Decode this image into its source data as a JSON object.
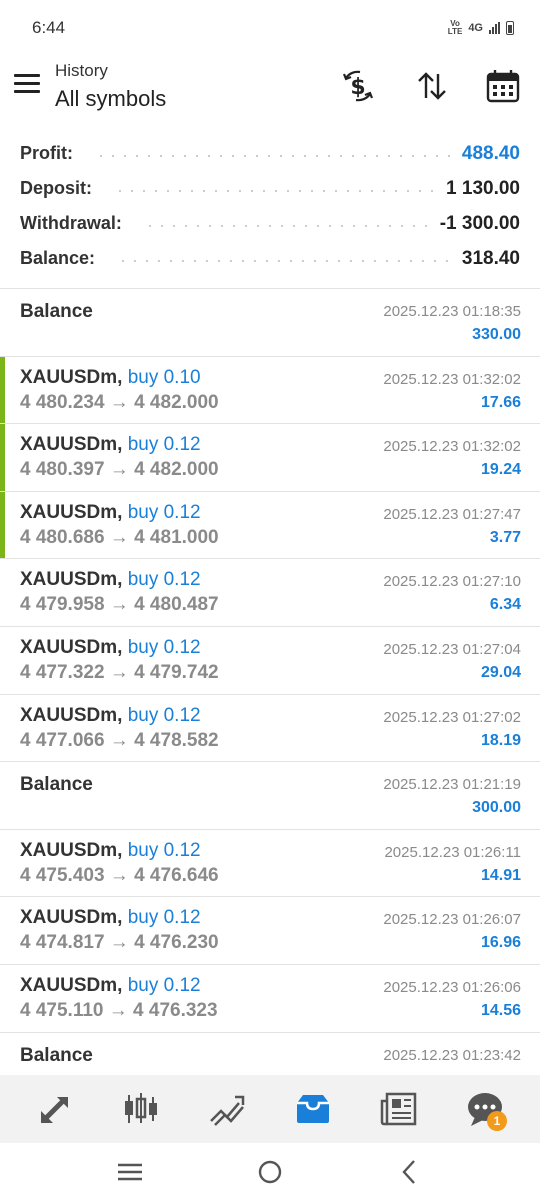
{
  "status_bar": {
    "time": "6:44",
    "volte": "VoLTE",
    "network": "4G"
  },
  "header": {
    "subtitle": "History",
    "title": "All symbols",
    "icons": [
      "dollar-exchange-icon",
      "sort-icon",
      "calendar-icon"
    ]
  },
  "summary": {
    "profit_label": "Profit:",
    "profit_value": "488.40",
    "deposit_label": "Deposit:",
    "deposit_value": "1 130.00",
    "withdrawal_label": "Withdrawal:",
    "withdrawal_value": "-1 300.00",
    "balance_label": "Balance:",
    "balance_value": "318.40"
  },
  "deals": [
    {
      "kind": "balance",
      "symbol": "Balance",
      "time": "2025.12.23 01:18:35",
      "profit": "330.00"
    },
    {
      "kind": "trade",
      "win": true,
      "symbol": "XAUUSDm,",
      "type": "buy 0.10",
      "prices": "4 480.234 → 4 482.000",
      "time": "2025.12.23 01:32:02",
      "profit": "17.66"
    },
    {
      "kind": "trade",
      "win": true,
      "symbol": "XAUUSDm,",
      "type": "buy 0.12",
      "prices": "4 480.397 → 4 482.000",
      "time": "2025.12.23 01:32:02",
      "profit": "19.24"
    },
    {
      "kind": "trade",
      "win": true,
      "symbol": "XAUUSDm,",
      "type": "buy 0.12",
      "prices": "4 480.686 → 4 481.000",
      "time": "2025.12.23 01:27:47",
      "profit": "3.77"
    },
    {
      "kind": "trade",
      "win": false,
      "symbol": "XAUUSDm,",
      "type": "buy 0.12",
      "prices": "4 479.958 → 4 480.487",
      "time": "2025.12.23 01:27:10",
      "profit": "6.34"
    },
    {
      "kind": "trade",
      "win": false,
      "symbol": "XAUUSDm,",
      "type": "buy 0.12",
      "prices": "4 477.322 → 4 479.742",
      "time": "2025.12.23 01:27:04",
      "profit": "29.04"
    },
    {
      "kind": "trade",
      "win": false,
      "symbol": "XAUUSDm,",
      "type": "buy 0.12",
      "prices": "4 477.066 → 4 478.582",
      "time": "2025.12.23 01:27:02",
      "profit": "18.19"
    },
    {
      "kind": "balance",
      "symbol": "Balance",
      "time": "2025.12.23 01:21:19",
      "profit": "300.00"
    },
    {
      "kind": "trade",
      "win": false,
      "symbol": "XAUUSDm,",
      "type": "buy 0.12",
      "prices": "4 475.403 → 4 476.646",
      "time": "2025.12.23 01:26:11",
      "profit": "14.91"
    },
    {
      "kind": "trade",
      "win": false,
      "symbol": "XAUUSDm,",
      "type": "buy 0.12",
      "prices": "4 474.817 → 4 476.230",
      "time": "2025.12.23 01:26:07",
      "profit": "16.96"
    },
    {
      "kind": "trade",
      "win": false,
      "symbol": "XAUUSDm,",
      "type": "buy 0.12",
      "prices": "4 475.110 → 4 476.323",
      "time": "2025.12.23 01:26:06",
      "profit": "14.56"
    },
    {
      "kind": "balance",
      "symbol": "Balance",
      "time": "2025.12.23 01:23:42",
      "profit": ""
    }
  ],
  "bottom_nav": {
    "items": [
      "quotes-icon",
      "chart-icon",
      "trade-icon",
      "history-icon",
      "news-icon",
      "chat-icon"
    ],
    "active": "history-icon",
    "chat_badge": "1"
  },
  "colors": {
    "accent_blue": "#1a7fd8",
    "win_green": "#7cb518",
    "badge_orange": "#f29a1a"
  }
}
